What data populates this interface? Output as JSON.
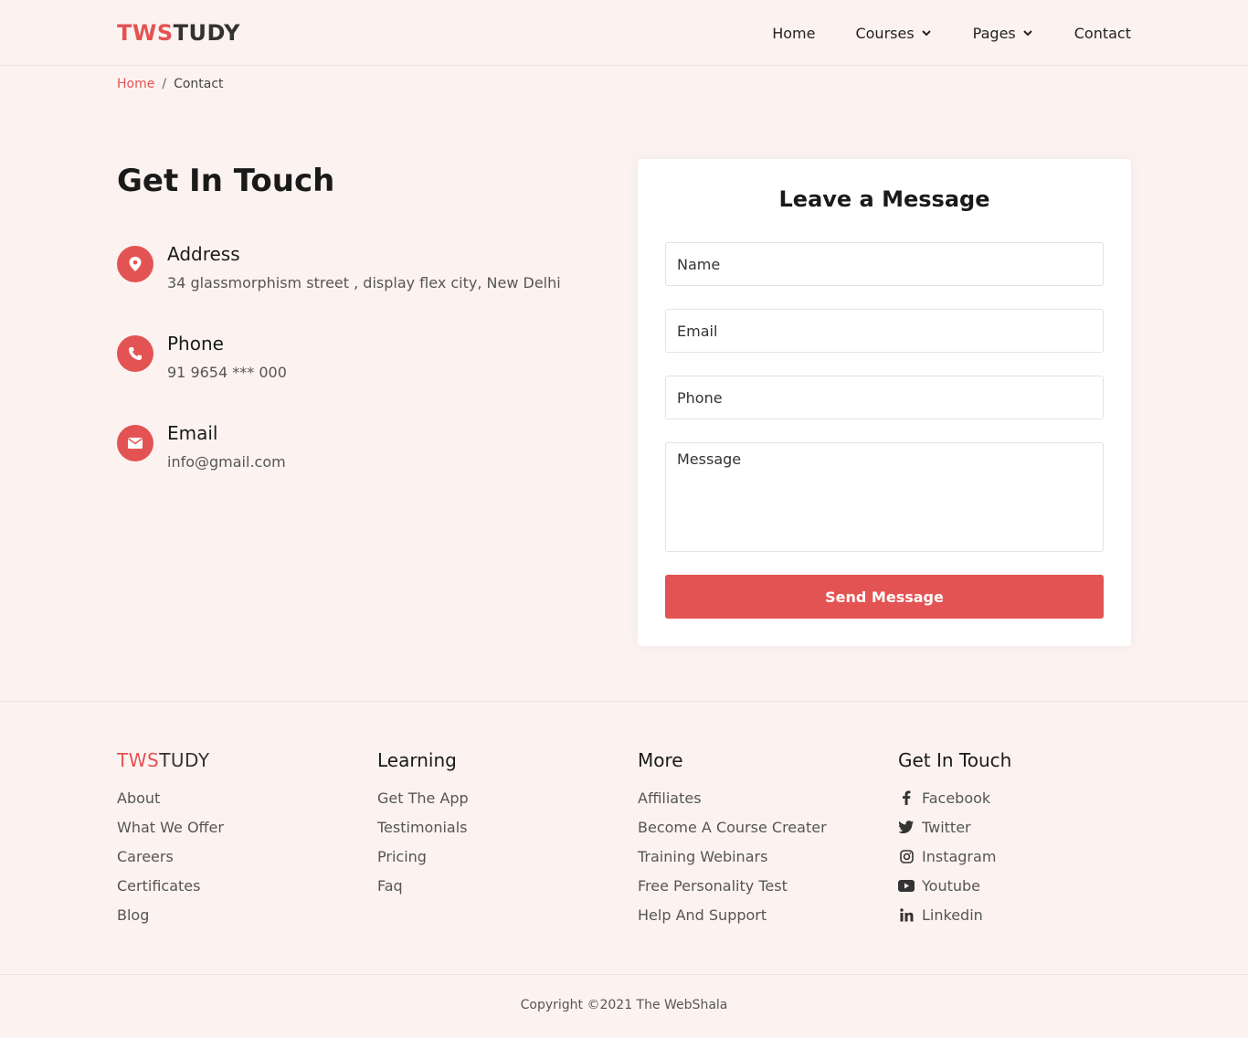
{
  "brand": {
    "part1": "TWS",
    "part2": "TUDY"
  },
  "nav": {
    "items": [
      {
        "label": "Home"
      },
      {
        "label": "Courses"
      },
      {
        "label": "Pages"
      },
      {
        "label": "Contact"
      }
    ]
  },
  "breadcrumb": {
    "home": "Home",
    "separator": "/",
    "current": "Contact"
  },
  "contact": {
    "title": "Get In Touch",
    "items": [
      {
        "label": "Address",
        "value": "34 glassmorphism street , display flex city, New Delhi",
        "icon": "map-pin-icon"
      },
      {
        "label": "Phone",
        "value": "91 9654 *** 000",
        "icon": "phone-icon"
      },
      {
        "label": "Email",
        "value": "info@gmail.com",
        "icon": "envelope-icon"
      }
    ]
  },
  "form": {
    "title": "Leave a Message",
    "name_placeholder": "Name",
    "email_placeholder": "Email",
    "phone_placeholder": "Phone",
    "message_placeholder": "Message",
    "submit_label": "Send Message"
  },
  "footer": {
    "brand": {
      "part1": "TWS",
      "part2": "TUDY"
    },
    "col1": [
      "About",
      "What We Offer",
      "Careers",
      "Certificates",
      "Blog"
    ],
    "learning": {
      "title": "Learning",
      "items": [
        "Get The App",
        "Testimonials",
        "Pricing",
        "Faq"
      ]
    },
    "more": {
      "title": "More",
      "items": [
        "Affiliates",
        "Become A Course Creater",
        "Training Webinars",
        "Free Personality Test",
        "Help And Support"
      ]
    },
    "touch": {
      "title": "Get In Touch",
      "items": [
        "Facebook",
        "Twitter",
        "Instagram",
        "Youtube",
        "Linkedin"
      ]
    },
    "copyright": "Copyright ©2021 The WebShala"
  },
  "colors": {
    "accent": "#e45353",
    "background": "#fcf3f1"
  }
}
